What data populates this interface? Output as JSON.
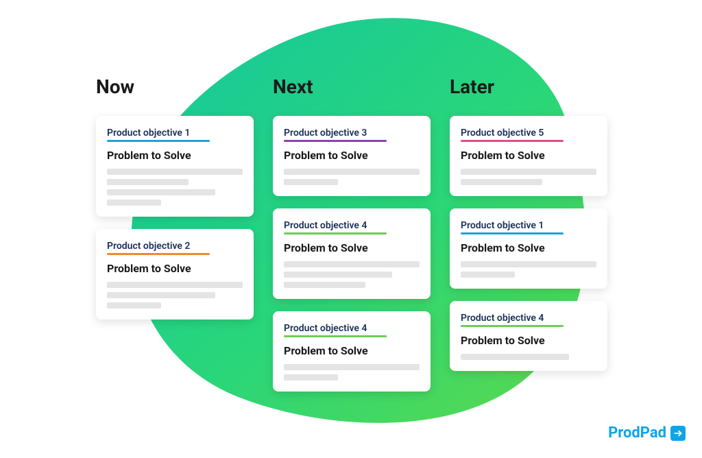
{
  "brand": {
    "name": "ProdPad"
  },
  "colors": {
    "obj1": "#1fa0e0",
    "obj2": "#f08a2c",
    "obj3": "#8b3fb8",
    "obj4": "#6ecb5a",
    "obj5": "#e84a8a"
  },
  "columns": [
    {
      "header": "Now",
      "cards": [
        {
          "objective": "Product objective 1",
          "color_key": "obj1",
          "title": "Problem to Solve",
          "lines": [
            "w100",
            "w60",
            "w80",
            "w40"
          ]
        },
        {
          "objective": "Product objective 2",
          "color_key": "obj2",
          "title": "Problem to Solve",
          "lines": [
            "w100",
            "w80",
            "w40"
          ]
        }
      ]
    },
    {
      "header": "Next",
      "cards": [
        {
          "objective": "Product objective 3",
          "color_key": "obj3",
          "title": "Problem to Solve",
          "lines": [
            "w100",
            "w40"
          ]
        },
        {
          "objective": "Product objective 4",
          "color_key": "obj4",
          "title": "Problem to Solve",
          "lines": [
            "w100",
            "w80",
            "w60"
          ]
        },
        {
          "objective": "Product objective 4",
          "color_key": "obj4",
          "title": "Problem to Solve",
          "lines": [
            "w100",
            "w40"
          ]
        }
      ]
    },
    {
      "header": "Later",
      "cards": [
        {
          "objective": "Product objective 5",
          "color_key": "obj5",
          "title": "Problem to Solve",
          "lines": [
            "w100",
            "w60"
          ]
        },
        {
          "objective": "Product objective 1",
          "color_key": "obj1",
          "title": "Problem to Solve",
          "lines": [
            "w100",
            "w40"
          ]
        },
        {
          "objective": "Product objective 4",
          "color_key": "obj4",
          "title": "Problem to Solve",
          "lines": [
            "w80"
          ]
        }
      ]
    }
  ]
}
